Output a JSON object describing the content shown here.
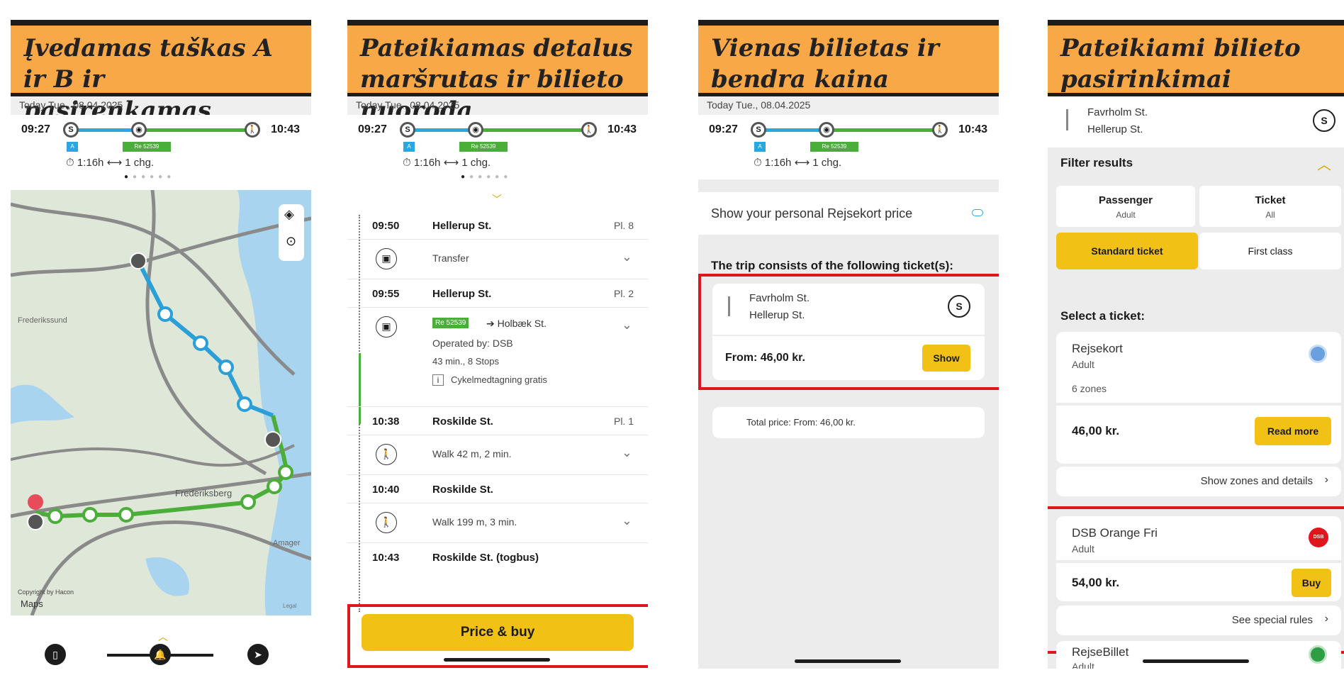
{
  "panel1": {
    "banner": "Įvedamas taškas A ir B ir pasirenkamas maršrutas",
    "date": "Today Tue., 08.04.2025",
    "dep_time": "09:27",
    "arr_time": "10:43",
    "bus_tag": "A",
    "train_tag": "Re 52539",
    "duration": "⏱ 1:16h ⟷ 1 chg.",
    "map_labels": [
      "Frederikssund",
      "Frederiksberg",
      "Amager",
      "Copyright by Hacon",
      "Maps",
      "Legal"
    ]
  },
  "panel2": {
    "banner": "Pateikiamas detalus maršrutas ir bilieto nuoroda",
    "date": "Today Tue., 08.04.2025",
    "dep_time": "09:27",
    "arr_time": "10:43",
    "bus_tag": "A",
    "train_tag": "Re 52539",
    "duration": "⏱ 1:16h ⟷ 1 chg.",
    "stops": [
      {
        "time": "09:50",
        "station": "Hellerup St.",
        "platform": "Pl. 8"
      },
      {
        "leg": "Transfer"
      },
      {
        "time": "09:55",
        "station": "Hellerup St.",
        "platform": "Pl. 2"
      },
      {
        "train": "Re 52539",
        "direction": "➔ Holbæk St.",
        "operator": "Operated by: DSB",
        "info": "43 min., 8 Stops",
        "bike": "Cykelmedtagning gratis"
      },
      {
        "time": "10:38",
        "station": "Roskilde St.",
        "platform": "Pl. 1"
      },
      {
        "leg": "Walk 42 m, 2 min."
      },
      {
        "time": "10:40",
        "station": "Roskilde St.",
        "platform": ""
      },
      {
        "leg": "Walk 199 m, 3 min."
      },
      {
        "time": "10:43",
        "station": "Roskilde St. (togbus)",
        "platform": ""
      }
    ],
    "price_button": "Price & buy"
  },
  "panel3": {
    "banner": "Vienas bilietas ir bendra kaina",
    "date": "Today Tue., 08.04.2025",
    "dep_time": "09:27",
    "arr_time": "10:43",
    "bus_tag": "A",
    "train_tag": "Re 52539",
    "duration": "⏱ 1:16h ⟷ 1 chg.",
    "rejsekort_toggle": "Show your personal Rejsekort price",
    "tickets_heading": "The trip consists of the following ticket(s):",
    "from_station": "Favrholm St.",
    "to_station": "Hellerup St.",
    "from_price": "From: 46,00 kr.",
    "show_button": "Show",
    "total_price": "Total price: From: 46,00 kr."
  },
  "panel4": {
    "banner": "Pateikiami bilieto pasirinkimai",
    "from_station": "Favrholm St.",
    "to_station": "Hellerup St.",
    "filter_title": "Filter results",
    "passenger_label": "Passenger",
    "passenger_value": "Adult",
    "ticket_label": "Ticket",
    "ticket_value": "All",
    "standard_tab": "Standard ticket",
    "first_tab": "First class",
    "select_heading": "Select a ticket:",
    "tickets": [
      {
        "name": "Rejsekort",
        "type": "Adult",
        "extra": "6 zones",
        "price": "46,00 kr.",
        "button": "Read more",
        "link": "Show zones and details",
        "color": "#6aa0dd"
      },
      {
        "name": "DSB Orange Fri",
        "type": "Adult",
        "price": "54,00 kr.",
        "button": "Buy",
        "link": "See special rules",
        "color": "#e0161d",
        "badge": "DSB"
      },
      {
        "name": "RejseBillet",
        "type": "Adult",
        "color": "#2e9e44"
      }
    ]
  },
  "colors": {
    "banner": "#f9a847",
    "accent_yellow": "#f2c116",
    "highlight_red": "#e0161d",
    "bus_blue": "#2aa6e0",
    "train_green": "#4cae3a"
  }
}
